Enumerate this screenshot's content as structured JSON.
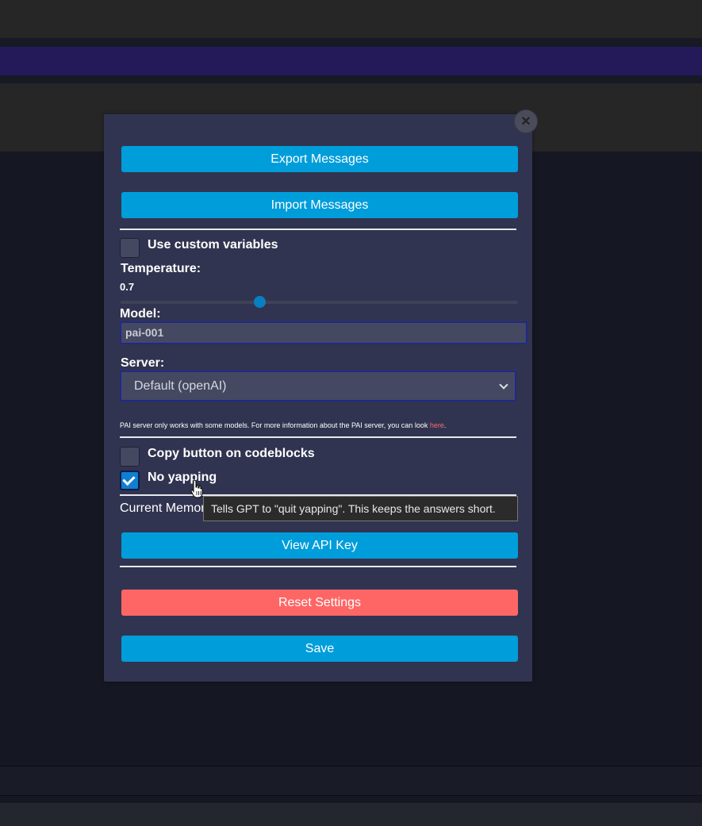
{
  "modal": {
    "close_label": "×",
    "export_label": "Export Messages",
    "import_label": "Import Messages",
    "custom_vars_label": "Use custom variables",
    "temperature_label": "Temperature:",
    "temperature_value": "0.7",
    "temperature_fraction": 0.35,
    "model_label": "Model:",
    "model_value": "pai-001",
    "server_label": "Server:",
    "server_selected": "Default (openAI)",
    "info_text": "PAI server only works with some models. For more information about the PAI server, you can look ",
    "info_link": "here",
    "info_end": ".",
    "copy_button_label": "Copy button on codeblocks",
    "copy_button_checked": false,
    "no_yapping_label": "No yapping",
    "no_yapping_checked": true,
    "memory_label": "Current Memory",
    "view_api_key_label": "View API Key",
    "reset_label": "Reset Settings",
    "save_label": "Save"
  },
  "tooltip": {
    "text": "Tells GPT to \"quit yapping\". This keeps the answers short."
  },
  "icons": {
    "close": "close-icon",
    "check": "check-icon",
    "chevron": "chevron-down-icon",
    "cursor": "hand-pointer-icon"
  },
  "colors": {
    "primary_button": "#009ddb",
    "danger_button": "#fe6666",
    "modal_bg": "#313450",
    "link": "#ff6b6b"
  }
}
